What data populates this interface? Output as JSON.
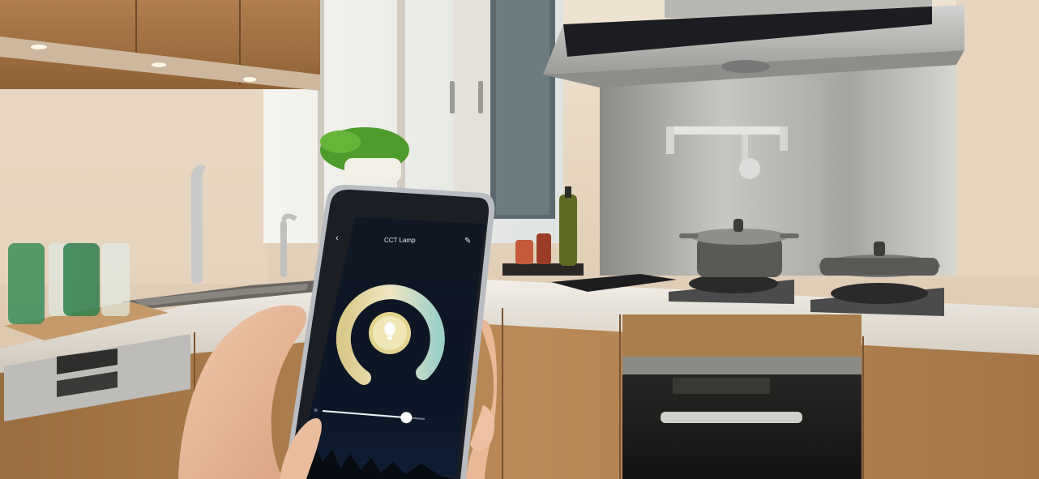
{
  "phone": {
    "app_title": "CCT Lamp",
    "carrier": "",
    "time": "",
    "brightness_label": ""
  },
  "dial": {
    "warm_color": "#f1e6a6",
    "cool_color": "#9fd0c8",
    "bulb_color": "#f3e9b0"
  },
  "brightness_slider": {
    "level": 0.82
  },
  "colors": {
    "wall": "#d9c2a6",
    "cabinet_wood": "#a57a4c",
    "counter": "#e7e1d7",
    "steel": "#b8b8b6",
    "phone_screen": "#0d1420"
  }
}
